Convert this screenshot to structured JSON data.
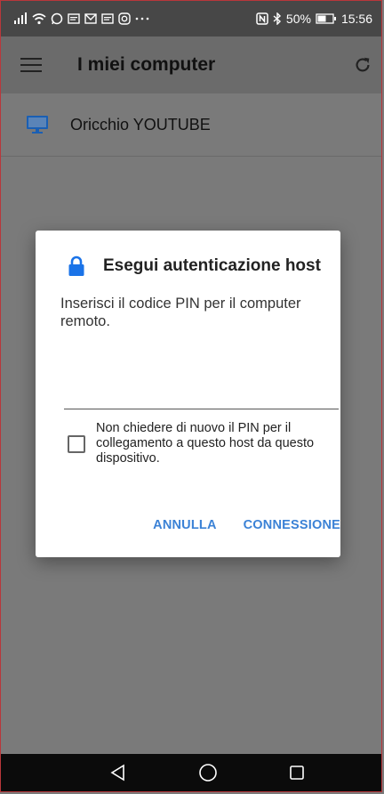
{
  "status_bar": {
    "left_icons": [
      "signal-icon",
      "wifi-icon",
      "whatsapp-icon",
      "message-icon",
      "mail-icon",
      "message-icon",
      "instagram-icon",
      "more-icon"
    ],
    "nfc_icon": "nfc-icon",
    "bluetooth_icon": "bluetooth-icon",
    "battery_percent": "50%",
    "time": "15:56"
  },
  "app_bar": {
    "title": "I miei computer",
    "menu_icon": "hamburger-icon",
    "refresh_icon": "refresh-icon"
  },
  "hosts": [
    {
      "name": "Oricchio YOUTUBE",
      "icon": "monitor-icon"
    }
  ],
  "dialog": {
    "title": "Esegui autenticazione host",
    "lock_icon": "lock-icon",
    "message": "Inserisci il codice PIN per il computer remoto.",
    "pin_value": "",
    "remember_label": "Non chiedere di nuovo il PIN per il collegamento a questo host da questo dispositivo.",
    "remember_checked": false,
    "cancel_label": "ANNULLA",
    "connect_label": "CONNESSIONE"
  },
  "nav_bar": {
    "back_icon": "back-triangle-icon",
    "home_icon": "home-circle-icon",
    "recents_icon": "recents-square-icon"
  },
  "colors": {
    "accent": "#3b82d6",
    "status_bar": "#474747",
    "app_bar": "#6b6b6b",
    "scrim_background": "#7a7a7a",
    "nav_bar": "#0b0b0b"
  }
}
